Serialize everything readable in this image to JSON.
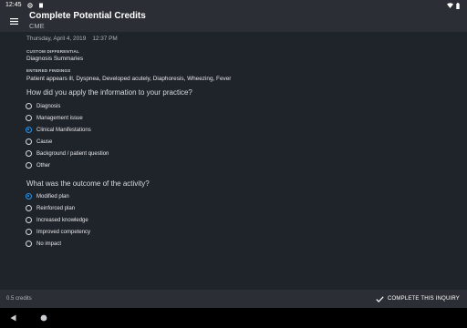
{
  "status_bar": {
    "time": "12:45"
  },
  "app_bar": {
    "title": "Complete Potential Credits",
    "subtitle": "CME"
  },
  "content": {
    "date_time": "Thursday, April 4, 2019    12:37 PM",
    "custom_differential": {
      "label": "CUSTOM DIFFERENTIAL",
      "value": "Diagnosis Summaries"
    },
    "entered_findings": {
      "label": "ENTERED FINDINGS",
      "value": "Patient appears ill, Dyspnea, Developed acutely, Diaphoresis, Wheezing, Fever"
    },
    "question1": {
      "text": "How did you apply the information to your practice?",
      "options": [
        {
          "label": "Diagnosis",
          "checked": false
        },
        {
          "label": "Management issue",
          "checked": false
        },
        {
          "label": "Clinical Manifestations",
          "checked": true
        },
        {
          "label": "Cause",
          "checked": false
        },
        {
          "label": "Background / patient question",
          "checked": false
        },
        {
          "label": "Other",
          "checked": false
        }
      ]
    },
    "question2": {
      "text": "What was the outcome of the activity?",
      "options": [
        {
          "label": "Modified plan",
          "checked": true
        },
        {
          "label": "Reinforced plan",
          "checked": false
        },
        {
          "label": "Increased knowledge",
          "checked": false
        },
        {
          "label": "Improved competency",
          "checked": false
        },
        {
          "label": "No impact",
          "checked": false
        }
      ]
    }
  },
  "bottom_bar": {
    "credits": "0.5 credits",
    "complete_label": "COMPLETE THIS INQUIRY"
  },
  "colors": {
    "accent": "#2196f3",
    "background": "#1f232a",
    "bar": "#2b2f35"
  }
}
